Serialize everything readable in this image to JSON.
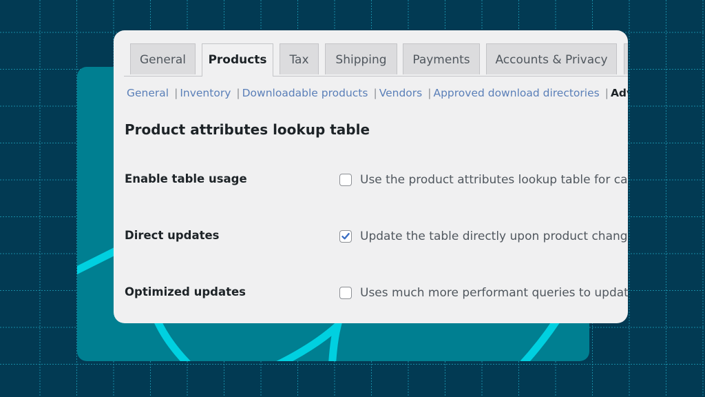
{
  "colors": {
    "background": "#023a53",
    "grid_line": "#1ea0b9",
    "teal_card": "#007f91",
    "accent_curve": "#00d0e0",
    "panel": "#f0f0f1",
    "link": "#5a7fb8",
    "checkmark": "#3b6fc4"
  },
  "tabs": [
    {
      "label": "General",
      "active": false
    },
    {
      "label": "Products",
      "active": true
    },
    {
      "label": "Tax",
      "active": false
    },
    {
      "label": "Shipping",
      "active": false
    },
    {
      "label": "Payments",
      "active": false
    },
    {
      "label": "Accounts & Privacy",
      "active": false
    }
  ],
  "subnav": {
    "links": [
      "General",
      "Inventory",
      "Downloadable products",
      "Vendors",
      "Approved download directories"
    ],
    "separator": "|",
    "current": "Adv"
  },
  "section": {
    "title": "Product attributes lookup table"
  },
  "settings": [
    {
      "label": "Enable table usage",
      "checked": false,
      "description": "Use the product attributes lookup table for cata"
    },
    {
      "label": "Direct updates",
      "checked": true,
      "description": "Update the table directly upon product change"
    },
    {
      "label": "Optimized updates",
      "checked": false,
      "description": "Uses much more performant queries to update"
    }
  ]
}
